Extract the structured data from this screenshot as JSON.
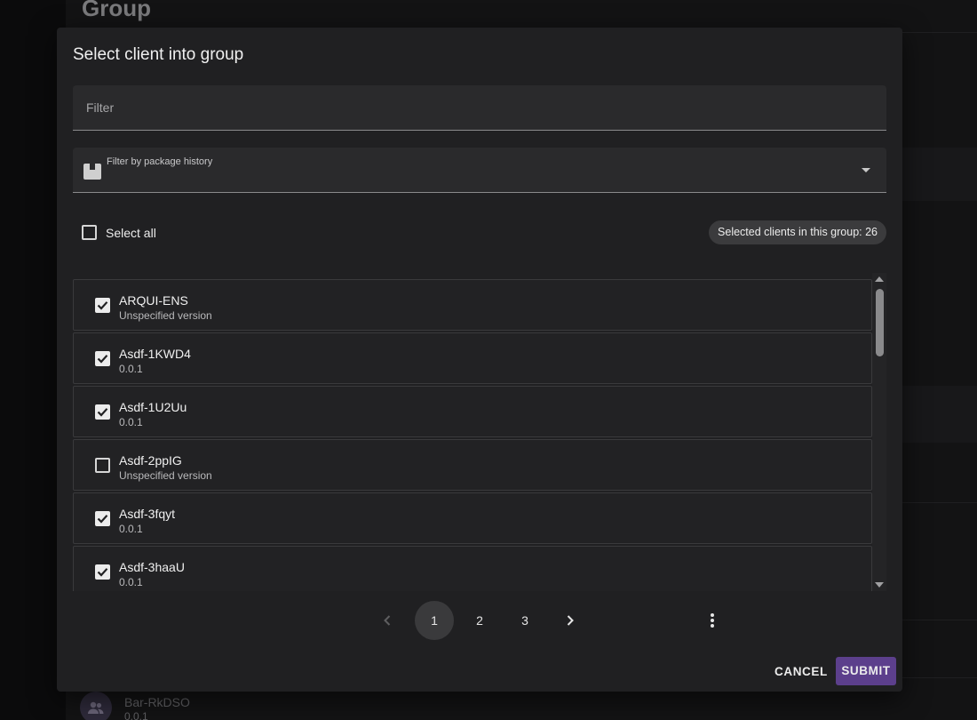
{
  "background": {
    "page_title": "Group",
    "last_item": {
      "name": "Bar-RkDSO",
      "version": "0.0.1"
    }
  },
  "dialog": {
    "title": "Select client into group",
    "filter_placeholder": "Filter",
    "package_filter_label": "Filter by package history",
    "select_all_label": "Select all",
    "select_all_checked": false,
    "selected_chip": "Selected clients in this group: 26",
    "clients": [
      {
        "name": "ARQUI-ENS",
        "version": "Unspecified version",
        "checked": true
      },
      {
        "name": "Asdf-1KWD4",
        "version": "0.0.1",
        "checked": true
      },
      {
        "name": "Asdf-1U2Uu",
        "version": "0.0.1",
        "checked": true
      },
      {
        "name": "Asdf-2ppIG",
        "version": "Unspecified version",
        "checked": false
      },
      {
        "name": "Asdf-3fqyt",
        "version": "0.0.1",
        "checked": true
      },
      {
        "name": "Asdf-3haaU",
        "version": "0.0.1",
        "checked": true
      }
    ],
    "pagination": {
      "pages": [
        "1",
        "2",
        "3"
      ],
      "current": "1"
    },
    "actions": {
      "cancel": "CANCEL",
      "submit": "SUBMIT"
    }
  },
  "colors": {
    "primary": "#5c3f8c",
    "dialog_bg": "#202022",
    "field_bg": "#2a2a2c"
  }
}
